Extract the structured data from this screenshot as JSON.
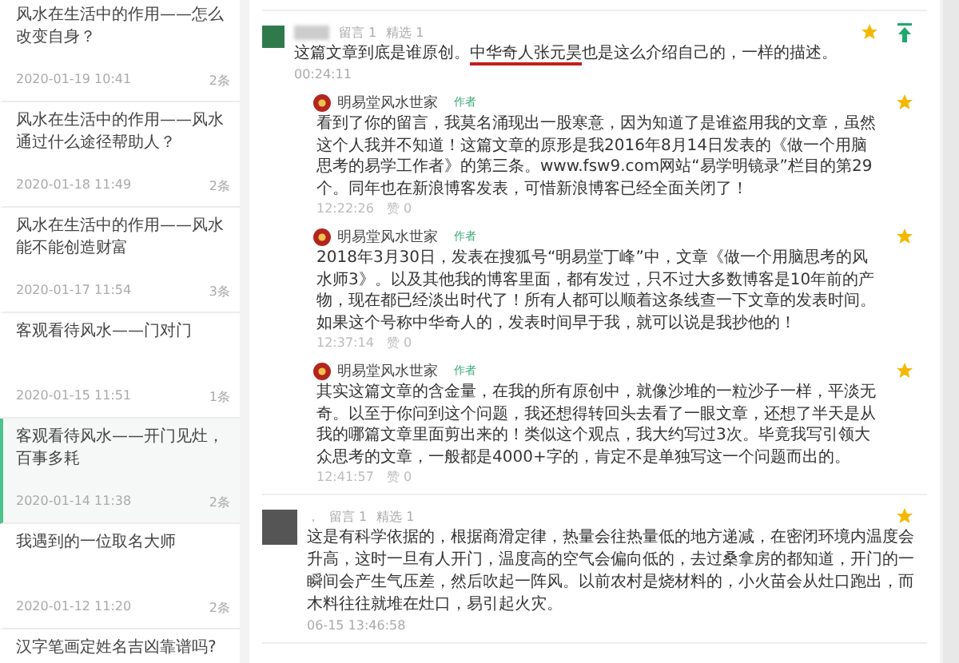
{
  "articles": [
    {
      "title": "风水在生活中的作用——怎么改变自身？",
      "date": "2020-01-19 10:41",
      "count": "2条",
      "selected": false
    },
    {
      "title": "风水在生活中的作用——风水通过什么途径帮助人？",
      "date": "2020-01-18 11:49",
      "count": "2条",
      "selected": false
    },
    {
      "title": "风水在生活中的作用——风水能不能创造财富",
      "date": "2020-01-17 11:54",
      "count": "3条",
      "selected": false
    },
    {
      "title": "客观看待风水——门对门",
      "date": "2020-01-15 11:51",
      "count": "1条",
      "selected": false
    },
    {
      "title": "客观看待风水——开门见灶，百事多耗",
      "date": "2020-01-14 11:38",
      "count": "2条",
      "selected": true
    },
    {
      "title": "我遇到的一位取名大师",
      "date": "2020-01-12 11:20",
      "count": "2条",
      "selected": false
    },
    {
      "title": "汉字笔画定姓名吉凶靠谱吗?",
      "selected": false
    }
  ],
  "comments": [
    {
      "kind": "square",
      "messages": "留言 1",
      "featured": "精选 1",
      "text_before": "这篇文章到底是谁原创。",
      "text_marked": "中华奇人张元昊",
      "text_after": "也是这么介绍自己的，一样的描述。",
      "time": "00:24:11",
      "pin": true,
      "replies": [
        {
          "author": "明易堂风水世家",
          "badge": "作者",
          "text": "看到了你的留言，我莫名涌现出一股寒意，因为知道了是谁盗用我的文章，虽然这个人我并不知道！这篇文章的原形是我2016年8月14日发表的《做一个用脑思考的易学工作者》的第三条。www.fsw9.com网站“易学明镜录”栏目的第29个。同年也在新浪博客发表，可惜新浪博客已经全面关闭了！",
          "time": "12:22:26",
          "likes": "赞 0"
        },
        {
          "author": "明易堂风水世家",
          "badge": "作者",
          "text": "2018年3月30日，发表在搜狐号“明易堂丁峰”中，文章《做一个用脑思考的风水师3》。以及其他我的博客里面，都有发过，只不过大多数博客是10年前的产物，现在都已经淡出时代了！所有人都可以顺着这条线查一下文章的发表时间。如果这个号称中华奇人的，发表时间早于我，就可以说是我抄他的！",
          "time": "12:37:14",
          "likes": "赞 0"
        },
        {
          "author": "明易堂风水世家",
          "badge": "作者",
          "text": "其实这篇文章的含金量，在我的所有原创中，就像沙堆的一粒沙子一样，平淡无奇。以至于你问到这个问题，我还想得转回头去看了一眼文章，还想了半天是从我的哪篇文章里面剪出来的！类似这个观点，我大约写过3次。毕竟我写引领大众思考的文章，一般都是4000+字的，肯定不是单独写这一个问题而出的。",
          "time": "12:41:57",
          "likes": "赞 0"
        }
      ]
    },
    {
      "kind": "photo",
      "name_prefix": "，",
      "messages": "留言 1",
      "featured": "精选 1",
      "text_before": "这是有科学依据的，根据商滑定律，热量会往热量低的地方递减，在密闭环境内温度会升高，这时一旦有人开门，温度高的空气会偏向低的，去过桑拿房的都知道，开门的一瞬间会产生气压差，然后吹起一阵风。以前农村是烧材料的，小火苗会从灶口跑出，而木料往往就堆在灶口，易引起火灾。",
      "time": "06-15 13:46:58",
      "pin": false
    }
  ]
}
